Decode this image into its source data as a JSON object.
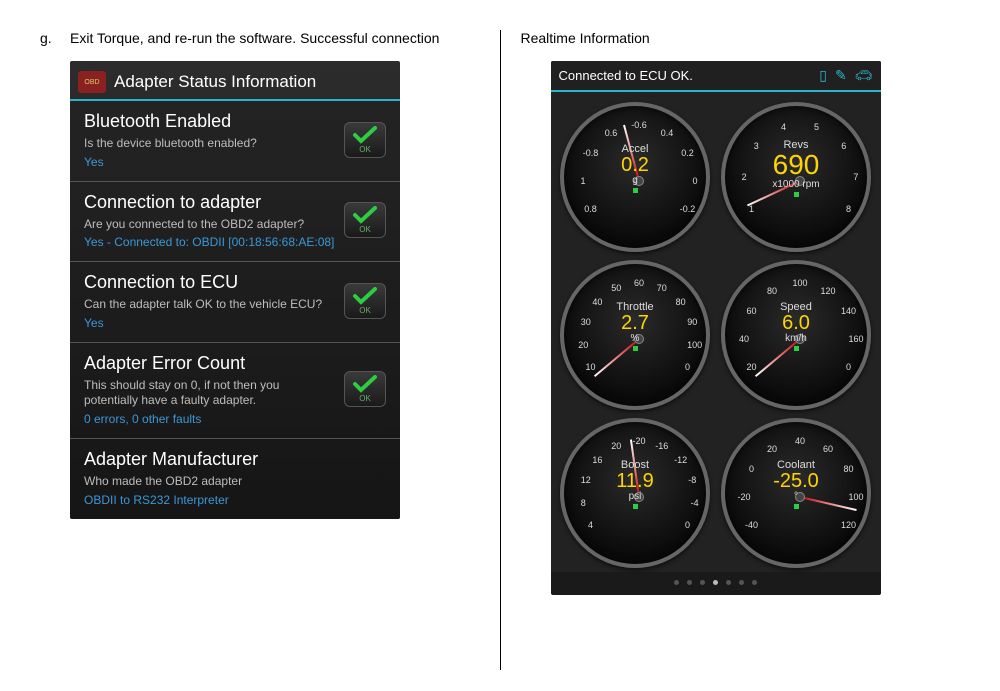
{
  "left": {
    "letter": "g.",
    "intro": "Exit Torque, and re-run the software. Successful connection",
    "header": "Adapter Status Information",
    "logo_text": "OBD",
    "items": [
      {
        "title": "Bluetooth Enabled",
        "desc": "Is the device bluetooth enabled?",
        "value": "Yes",
        "ok": "OK"
      },
      {
        "title": "Connection to adapter",
        "desc": "Are you connected to the OBD2 adapter?",
        "value": "Yes - Connected to: OBDII [00:18:56:68:AE:08]",
        "ok": "OK"
      },
      {
        "title": "Connection to ECU",
        "desc": "Can the adapter talk OK to the vehicle ECU?",
        "value": "Yes",
        "ok": "OK"
      },
      {
        "title": "Adapter Error Count",
        "desc": "This should stay on 0, if not then you potentially have a faulty adapter.",
        "value": "0 errors, 0 other faults",
        "ok": "OK"
      },
      {
        "title": "Adapter Manufacturer",
        "desc": "Who made the OBD2 adapter",
        "value": "OBDII to RS232 Interpreter",
        "ok": ""
      }
    ]
  },
  "right": {
    "title": "Realtime Information",
    "status": "Connected to ECU OK.",
    "gauges": [
      {
        "label": "Accel",
        "value": "0.2",
        "unit": "g",
        "needle_deg": -15,
        "ticks": [
          "0.8",
          "1",
          "-0.8",
          "0.6",
          "-0.6",
          "0.4",
          "0.2",
          "0",
          "-0.2"
        ]
      },
      {
        "label": "Revs",
        "value": "690",
        "unit": "x1000 rpm",
        "needle_deg": -115,
        "big": true,
        "ticks": [
          "1",
          "2",
          "3",
          "4",
          "5",
          "6",
          "7",
          "8"
        ]
      },
      {
        "label": "Throttle",
        "value": "2.7",
        "unit": "%",
        "needle_deg": -130,
        "ticks": [
          "10",
          "20",
          "30",
          "40",
          "50",
          "60",
          "70",
          "80",
          "90",
          "100",
          "0"
        ]
      },
      {
        "label": "Speed",
        "value": "6.0",
        "unit": "km/h",
        "needle_deg": -130,
        "ticks": [
          "20",
          "40",
          "60",
          "80",
          "100",
          "120",
          "140",
          "160",
          "0"
        ]
      },
      {
        "label": "Boost",
        "value": "11.9",
        "unit": "psi",
        "needle_deg": -8,
        "ticks": [
          "4",
          "8",
          "12",
          "16",
          "20",
          "-20",
          "-16",
          "-12",
          "-8",
          "-4",
          "0"
        ]
      },
      {
        "label": "Coolant",
        "value": "-25.0",
        "unit": "°",
        "needle_deg": 103,
        "ticks": [
          "-40",
          "-20",
          "0",
          "20",
          "40",
          "60",
          "80",
          "100",
          "120"
        ]
      }
    ],
    "page_indicator": {
      "count": 7,
      "active": 3
    }
  }
}
